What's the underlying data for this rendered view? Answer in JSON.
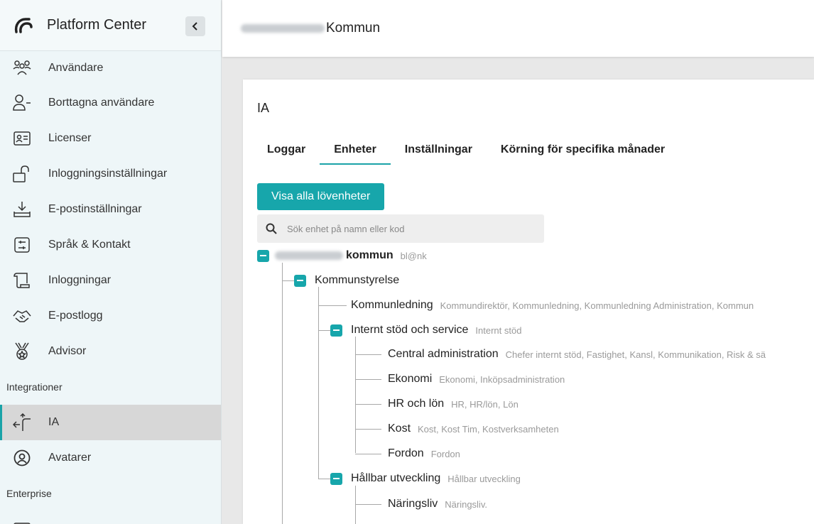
{
  "app": {
    "title": "Platform Center"
  },
  "sidebar": {
    "items": [
      {
        "label": "Användare",
        "icon": "users-icon"
      },
      {
        "label": "Borttagna användare",
        "icon": "user-minus-icon"
      },
      {
        "label": "Licenser",
        "icon": "id-card-icon"
      },
      {
        "label": "Inloggningsinställningar",
        "icon": "unlock-icon"
      },
      {
        "label": "E-postinställningar",
        "icon": "download-tray-icon"
      },
      {
        "label": "Språk & Kontakt",
        "icon": "sliders-icon"
      },
      {
        "label": "Inloggningar",
        "icon": "scroll-icon"
      },
      {
        "label": "E-postlogg",
        "icon": "handshake-icon"
      },
      {
        "label": "Advisor",
        "icon": "medal-icon"
      }
    ],
    "section_integrations": "Integrationer",
    "integration_items": [
      {
        "label": "IA",
        "icon": "arrows-icon",
        "active": true
      },
      {
        "label": "Avatarer",
        "icon": "avatar-circle-icon"
      }
    ],
    "section_enterprise": "Enterprise"
  },
  "topbar": {
    "title": "Kommun"
  },
  "card": {
    "title": "IA",
    "tabs": [
      {
        "label": "Loggar"
      },
      {
        "label": "Enheter",
        "active": true
      },
      {
        "label": "Inställningar"
      },
      {
        "label": "Körning för specifika månader"
      }
    ],
    "show_all_button": "Visa alla lövenheter",
    "search_placeholder": "Sök enhet på namn eller kod"
  },
  "tree": {
    "root": {
      "name": "kommun",
      "code": "bl@nk"
    },
    "kommunstyrelse": {
      "name": "Kommunstyrelse",
      "code": ""
    },
    "kommunledning": {
      "name": "Kommunledning",
      "code": "Kommundirektör, Kommunledning, Kommunledning Administration, Kommun"
    },
    "internt": {
      "name": "Internt stöd och service",
      "code": "Internt stöd"
    },
    "central": {
      "name": "Central administration",
      "code": "Chefer internt stöd, Fastighet, Kansl, Kommunikation, Risk & sä"
    },
    "ekonomi": {
      "name": "Ekonomi",
      "code": "Ekonomi, Inköpsadministration"
    },
    "hr": {
      "name": "HR och lön",
      "code": "HR, HR/lön, Lön"
    },
    "kost": {
      "name": "Kost",
      "code": "Kost, Kost Tim, Kostverksamheten"
    },
    "fordon": {
      "name": "Fordon",
      "code": "Fordon"
    },
    "hallbar": {
      "name": "Hållbar utveckling",
      "code": "Hållbar utveckling"
    },
    "naringsliv": {
      "name": "Näringsliv",
      "code": "Näringsliv."
    }
  },
  "colors": {
    "accent": "#17a6ab",
    "sidebar_bg": "#eef6f8",
    "active_bg": "#d7d7d7"
  }
}
